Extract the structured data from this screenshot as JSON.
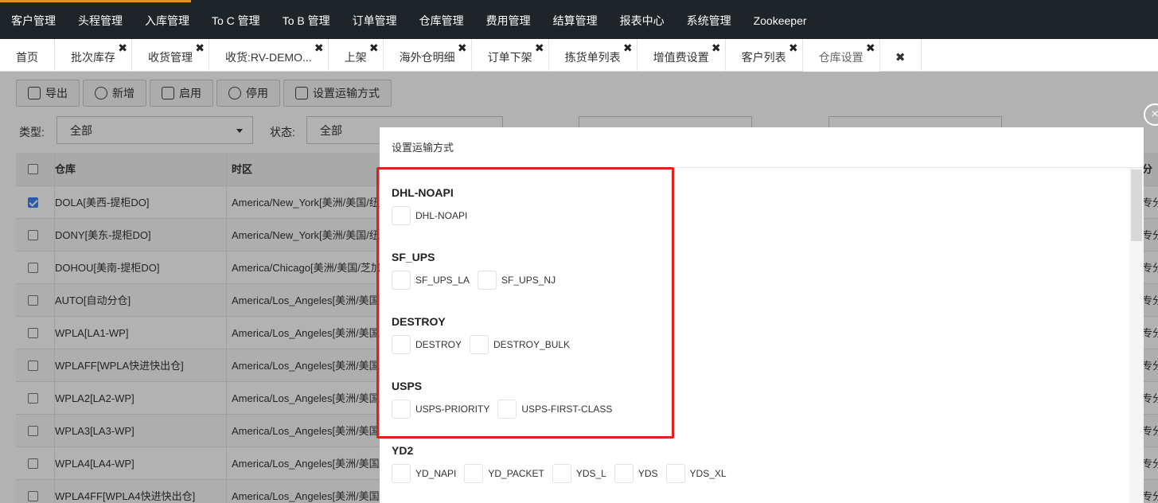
{
  "topnav": {
    "items": [
      "客户管理",
      "头程管理",
      "入库管理",
      "To C 管理",
      "To B 管理",
      "订单管理",
      "仓库管理",
      "费用管理",
      "结算管理",
      "报表中心",
      "系统管理",
      "Zookeeper"
    ],
    "accent_color": "#f08a24"
  },
  "tabs": [
    {
      "label": "首页",
      "closable": false
    },
    {
      "label": "批次库存",
      "closable": true
    },
    {
      "label": "收货管理",
      "closable": true
    },
    {
      "label": "收货:RV-DEMO...",
      "closable": true
    },
    {
      "label": "上架",
      "closable": true
    },
    {
      "label": "海外仓明细",
      "closable": true
    },
    {
      "label": "订单下架",
      "closable": true
    },
    {
      "label": "拣货单列表",
      "closable": true
    },
    {
      "label": "增值费设置",
      "closable": true
    },
    {
      "label": "客户列表",
      "closable": true
    },
    {
      "label": "仓库设置",
      "closable": true,
      "active": true
    }
  ],
  "tab_close_symbol": "✖",
  "toolbar": {
    "export_label": "导出",
    "add_label": "新增",
    "enable_label": "启用",
    "disable_label": "停用",
    "shipping_label": "设置运输方式"
  },
  "filters": {
    "type_label": "类型:",
    "type_value": "全部",
    "status_label": "状态:",
    "status_value": "全部"
  },
  "grid": {
    "columns": [
      "仓库",
      "时区",
      "分"
    ],
    "rows": [
      {
        "warehouse": "DOLA[美西-提柜DO]",
        "timezone": "America/New_York[美洲/美国/纽",
        "checked": true,
        "tail": "专分"
      },
      {
        "warehouse": "DONY[美东-提柜DO]",
        "timezone": "America/New_York[美洲/美国/纽",
        "checked": false,
        "tail": "专分"
      },
      {
        "warehouse": "DOHOU[美南-提柜DO]",
        "timezone": "America/Chicago[美洲/美国/芝加",
        "checked": false,
        "tail": "专分"
      },
      {
        "warehouse": "AUTO[自动分仓]",
        "timezone": "America/Los_Angeles[美洲/美国/",
        "checked": false,
        "tail": "专分"
      },
      {
        "warehouse": "WPLA[LA1-WP]",
        "timezone": "America/Los_Angeles[美洲/美国/",
        "checked": false,
        "tail": "专分"
      },
      {
        "warehouse": "WPLAFF[WPLA快进快出仓]",
        "timezone": "America/Los_Angeles[美洲/美国/",
        "checked": false,
        "tail": "专分"
      },
      {
        "warehouse": "WPLA2[LA2-WP]",
        "timezone": "America/Los_Angeles[美洲/美国/",
        "checked": false,
        "tail": "专分"
      },
      {
        "warehouse": "WPLA3[LA3-WP]",
        "timezone": "America/Los_Angeles[美洲/美国/",
        "checked": false,
        "tail": "专分"
      },
      {
        "warehouse": "WPLA4[LA4-WP]",
        "timezone": "America/Los_Angeles[美洲/美国/",
        "checked": false,
        "tail": "专分"
      },
      {
        "warehouse": "WPLA4FF[WPLA4快进快出仓]",
        "timezone": "America/Los_Angeles[美洲/美国/",
        "checked": false,
        "tail": "专分"
      }
    ]
  },
  "modal": {
    "title": "设置运输方式",
    "groups": [
      {
        "name": "DHL-NOAPI",
        "options": [
          "DHL-NOAPI"
        ]
      },
      {
        "name": "SF_UPS",
        "options": [
          "SF_UPS_LA",
          "SF_UPS_NJ"
        ]
      },
      {
        "name": "DESTROY",
        "options": [
          "DESTROY",
          "DESTROY_BULK"
        ]
      },
      {
        "name": "USPS",
        "options": [
          "USPS-PRIORITY",
          "USPS-FIRST-CLASS"
        ]
      },
      {
        "name": "YD2",
        "options": [
          "YD_NAPI",
          "YD_PACKET",
          "YDS_L",
          "YDS",
          "YDS_XL"
        ]
      }
    ],
    "close_symbol": "×",
    "highlight_color": "#e0221c"
  }
}
